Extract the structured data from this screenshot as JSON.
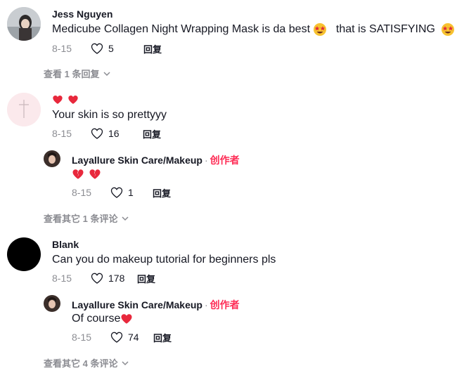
{
  "comments": [
    {
      "user": "Jess Nguyen",
      "text": "Medicube Collagen Night Wrapping Mask is da best",
      "text_mid": "that is SATISFYING",
      "date": "8-15",
      "likes": "5",
      "reply_label": "回复",
      "view_replies": "查看 1 条回复"
    },
    {
      "user": "",
      "text": "Your skin is so prettyyy",
      "date": "8-15",
      "likes": "16",
      "reply_label": "回复",
      "reply": {
        "user": "Layallure Skin Care/Makeup",
        "separator": "·",
        "badge": "创作者",
        "date": "8-15",
        "likes": "1",
        "reply_label": "回复"
      },
      "view_replies": "查看其它 1 条评论"
    },
    {
      "user": "Blank",
      "text": "Can you do makeup tutorial for beginners pls",
      "date": "8-15",
      "likes": "178",
      "reply_label": "回复",
      "reply": {
        "user": "Layallure Skin Care/Makeup",
        "separator": "·",
        "badge": "创作者",
        "text": "Of course",
        "date": "8-15",
        "likes": "74",
        "reply_label": "回复"
      },
      "view_replies": "查看其它 4 条评论"
    }
  ],
  "colors": {
    "creator_badge": "#fe2c55",
    "text": "#161823",
    "muted": "#8a8b91",
    "heart_emoji": "#e8283c"
  },
  "icons": [
    "heart-outline-icon",
    "chevron-down-icon",
    "star-eyes-emoji",
    "red-heart-emoji",
    "broken-heart-emoji"
  ]
}
